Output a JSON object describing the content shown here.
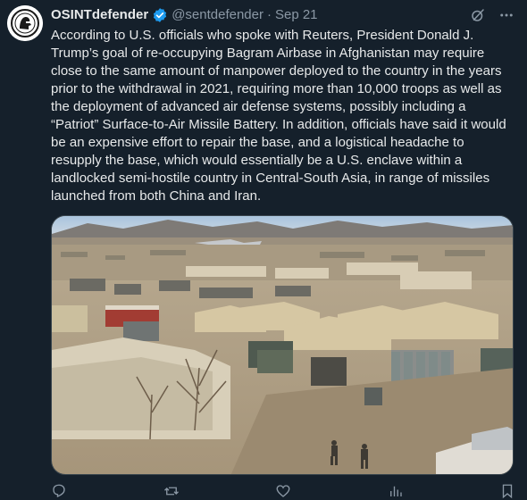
{
  "tweet": {
    "author_name": "OSINTdefender",
    "handle": "@sentdefender",
    "separator": "·",
    "date": "Sep 21",
    "text": "According to U.S. officials who spoke with Reuters, President Donald J. Trump’s goal of re-occupying Bagram Airbase in Afghanistan may require close to the same amount of manpower deployed to the country in the years prior to the withdrawal in 2021, requiring more than 10,000 troops as well as the deployment of advanced air defense systems, possibly including a “Patriot” Surface-to-Air Missile Battery. In addition, officials have said it would be an expensive effort to repair the base, and a logistical headache to resupply the base, which would essentially be a U.S. enclave within a landlocked semi-hostile country in Central-South Asia, in range of missiles launched from both China and Iran."
  },
  "icons": {
    "verified": "verified-badge-icon",
    "grok": "grok-icon",
    "more": "more-icon",
    "reply": "reply-icon",
    "retweet": "retweet-icon",
    "like": "like-icon",
    "views": "views-icon",
    "bookmark": "bookmark-icon"
  },
  "colors": {
    "background": "#15202b",
    "text": "#e7e9ea",
    "secondary": "#8b98a5",
    "verified": "#1d9bf0",
    "border": "#38444d"
  }
}
